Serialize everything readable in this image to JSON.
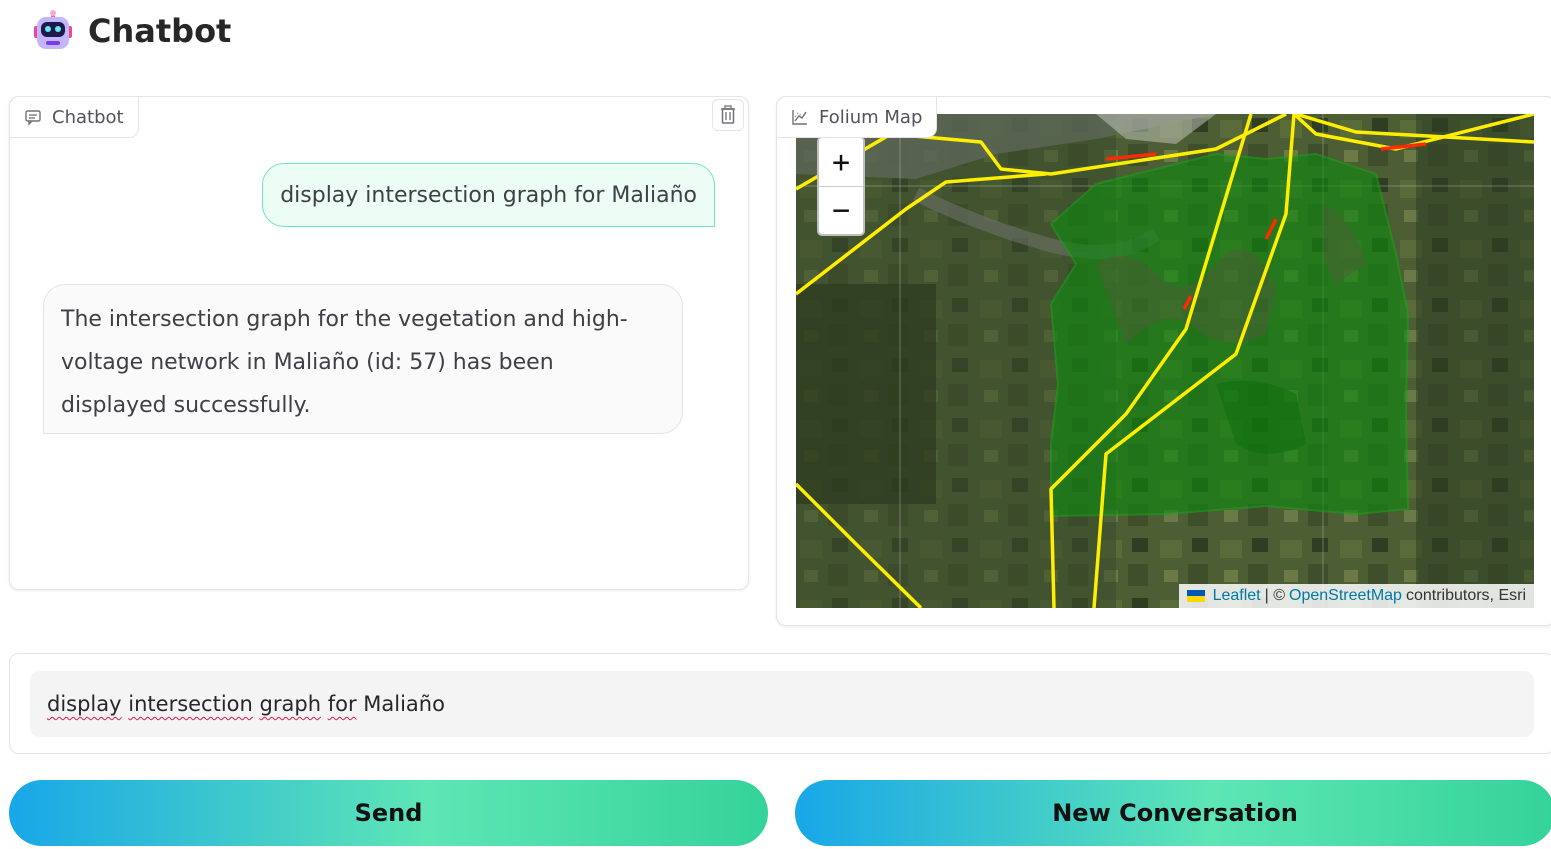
{
  "header": {
    "title": "Chatbot",
    "icon": "robot-icon"
  },
  "chatbot": {
    "tab_label": "Chatbot",
    "tab_icon": "chat-icon",
    "clear_icon": "trash-icon",
    "messages": [
      {
        "role": "user",
        "text": "display intersection graph for Maliaño"
      },
      {
        "role": "assistant",
        "text": "The intersection graph for the vegetation and high-voltage network in Maliaño (id: 57) has been displayed successfully."
      }
    ]
  },
  "map": {
    "tab_label": "Folium Map",
    "tab_icon": "chart-icon",
    "zoom_in": "+",
    "zoom_out": "−",
    "attribution": {
      "leaflet": "Leaflet",
      "separator": "| ©",
      "osm": "OpenStreetMap",
      "rest": "contributors, Esri"
    },
    "colors": {
      "power_line": "#ffee00",
      "vegetation": "#138a13",
      "intersection": "#ff2a00"
    }
  },
  "input": {
    "value_words": [
      "display",
      "intersection",
      "graph",
      "for"
    ],
    "value_rest": "Maliaño"
  },
  "buttons": {
    "send": "Send",
    "new_conversation": "New Conversation"
  }
}
